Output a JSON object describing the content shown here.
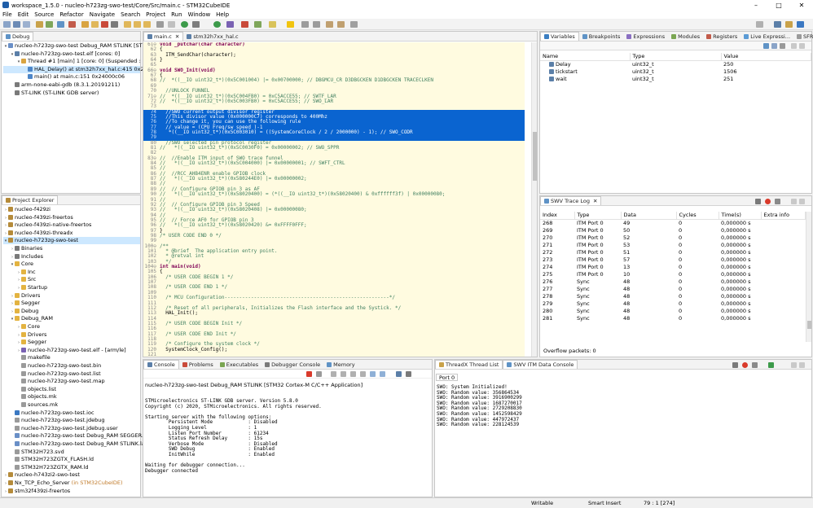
{
  "window": {
    "title": "workspace_1.5.0 - nucleo-h723zg-swo-test/Core/Src/main.c - STM32CubeIDE",
    "minimize": "–",
    "maximize": "□",
    "close": "✕"
  },
  "menu": [
    "File",
    "Edit",
    "Source",
    "Refactor",
    "Navigate",
    "Search",
    "Project",
    "Run",
    "Window",
    "Help"
  ],
  "debug_view": {
    "tab": "Debug",
    "tree": [
      {
        "text": "nucleo-h723zg-swo-test Debug_RAM STLINK [STM32 C",
        "indent": 0,
        "arrow": "▾",
        "icon": "#6a8fc7"
      },
      {
        "text": "nucleo-h723zg-swo-test.elf [cores: 0]",
        "indent": 1,
        "arrow": "▾",
        "icon": "#5b7fa8"
      },
      {
        "text": "Thread #1 [main] 1 [core: 0] (Suspended : Signal :",
        "indent": 2,
        "arrow": "▾",
        "icon": "#d9a441"
      },
      {
        "text": "HAL_Delay() at stm32h7xx_hal.c:415 0x240029",
        "indent": 3,
        "arrow": "",
        "icon": "#4d86c9",
        "selected": true
      },
      {
        "text": "main() at main.c:151 0x24000c06",
        "indent": 3,
        "arrow": "",
        "icon": "#4d86c9"
      },
      {
        "text": "arm-none-eabi-gdb (8.3.1.20191211)",
        "indent": 1,
        "arrow": "",
        "icon": "#7a7a7a"
      },
      {
        "text": "ST-LINK (ST-LINK GDB server)",
        "indent": 1,
        "arrow": "",
        "icon": "#7a7a7a"
      }
    ]
  },
  "project_explorer": {
    "tab": "Project Explorer",
    "tree": [
      {
        "text": "nucleo-f429zi",
        "indent": 0,
        "arrow": "›",
        "icon": "#b58b3a"
      },
      {
        "text": "nucleo-f439zi-freertos",
        "indent": 0,
        "arrow": "›",
        "icon": "#b58b3a"
      },
      {
        "text": "nucleo-f439zi-native-freertos",
        "indent": 0,
        "arrow": "›",
        "icon": "#b58b3a"
      },
      {
        "text": "nucleo-f439zi-threadx",
        "indent": 0,
        "arrow": "›",
        "icon": "#b58b3a"
      },
      {
        "text": "nucleo-h723zg-swo-test",
        "indent": 0,
        "arrow": "▾",
        "icon": "#b58b3a",
        "selected": true
      },
      {
        "text": "Binaries",
        "indent": 1,
        "arrow": "›",
        "icon": "#7a7a7a"
      },
      {
        "text": "Includes",
        "indent": 1,
        "arrow": "›",
        "icon": "#7a7a7a"
      },
      {
        "text": "Core",
        "indent": 1,
        "arrow": "▾",
        "icon": "#e3b341"
      },
      {
        "text": "Inc",
        "indent": 2,
        "arrow": "›",
        "icon": "#e3b341"
      },
      {
        "text": "Src",
        "indent": 2,
        "arrow": "›",
        "icon": "#e3b341"
      },
      {
        "text": "Startup",
        "indent": 2,
        "arrow": "›",
        "icon": "#e3b341"
      },
      {
        "text": "Drivers",
        "indent": 1,
        "arrow": "›",
        "icon": "#e3b341"
      },
      {
        "text": "Segger",
        "indent": 1,
        "arrow": "›",
        "icon": "#e3b341"
      },
      {
        "text": "Debug",
        "indent": 1,
        "arrow": "›",
        "icon": "#e3b341"
      },
      {
        "text": "Debug_RAM",
        "indent": 1,
        "arrow": "▾",
        "icon": "#e3b341"
      },
      {
        "text": "Core",
        "indent": 2,
        "arrow": "›",
        "icon": "#e3b341"
      },
      {
        "text": "Drivers",
        "indent": 2,
        "arrow": "›",
        "icon": "#e3b341"
      },
      {
        "text": "Segger",
        "indent": 2,
        "arrow": "›",
        "icon": "#e3b341"
      },
      {
        "text": "nucleo-h723zg-swo-test.elf - [arm/le]",
        "indent": 2,
        "arrow": "›",
        "icon": "#7a62b3"
      },
      {
        "text": "makefile",
        "indent": 2,
        "arrow": "",
        "icon": "#9a9a9a"
      },
      {
        "text": "nucleo-h723zg-swo-test.bin",
        "indent": 2,
        "arrow": "",
        "icon": "#9a9a9a"
      },
      {
        "text": "nucleo-h723zg-swo-test.list",
        "indent": 2,
        "arrow": "",
        "icon": "#9a9a9a"
      },
      {
        "text": "nucleo-h723zg-swo-test.map",
        "indent": 2,
        "arrow": "",
        "icon": "#9a9a9a"
      },
      {
        "text": "objects.list",
        "indent": 2,
        "arrow": "",
        "icon": "#9a9a9a"
      },
      {
        "text": "objects.mk",
        "indent": 2,
        "arrow": "",
        "icon": "#9a9a9a"
      },
      {
        "text": "sources.mk",
        "indent": 2,
        "arrow": "",
        "icon": "#9a9a9a"
      },
      {
        "text": "nucleo-h723zg-swo-test.ioc",
        "indent": 1,
        "arrow": "",
        "icon": "#3b78c2"
      },
      {
        "text": "nucleo-h723zg-swo-test.jdebug",
        "indent": 1,
        "arrow": "",
        "icon": "#9a9a9a"
      },
      {
        "text": "nucleo-h723zg-swo-test.jdebug.user",
        "indent": 1,
        "arrow": "",
        "icon": "#9a9a9a"
      },
      {
        "text": "nucleo-h723zg-swo-test Debug_RAM SEGGER.launc",
        "indent": 1,
        "arrow": "",
        "icon": "#6a8fc7"
      },
      {
        "text": "nucleo-h723zg-swo-test Debug_RAM STLINK.launch",
        "indent": 1,
        "arrow": "",
        "icon": "#6a8fc7"
      },
      {
        "text": "STM32H723.svd",
        "indent": 1,
        "arrow": "",
        "icon": "#9a9a9a"
      },
      {
        "text": "STM32H723ZGTX_FLASH.ld",
        "indent": 1,
        "arrow": "",
        "icon": "#9a9a9a"
      },
      {
        "text": "STM32H723ZGTX_RAM.ld",
        "indent": 1,
        "arrow": "",
        "icon": "#9a9a9a"
      },
      {
        "text": "nucleo-h743zi2-swo-test",
        "indent": 0,
        "arrow": "›",
        "icon": "#b58b3a"
      },
      {
        "text": "Nx_TCP_Echo_Server",
        "suffix": " (in STM32CubeIDE)",
        "indent": 0,
        "arrow": "›",
        "icon": "#b58b3a"
      },
      {
        "text": "stm32f439zi-freertos",
        "indent": 0,
        "arrow": "›",
        "icon": "#b58b3a"
      }
    ]
  },
  "editor": {
    "tabs": [
      "main.c",
      "stm32h7xx_hal.c"
    ],
    "lines": [
      {
        "n": "61⊖",
        "code": "void _putchar(char character)",
        "kw": true
      },
      {
        "n": "62",
        "code": "{"
      },
      {
        "n": "63",
        "code": "  ITM_SendChar(character);"
      },
      {
        "n": "64",
        "code": "}"
      },
      {
        "n": "65",
        "code": ""
      },
      {
        "n": "66⊖",
        "code": "void SWO_Init(void)",
        "kw": true
      },
      {
        "n": "67",
        "code": "{"
      },
      {
        "n": "68",
        "code": "//  *((__IO uint32_t*)(0x5C001004) |= 0x00700000; // DBGMCU_CR D3DBGCKEN D1DBGCKEN TRACECLKEN",
        "cm": true
      },
      {
        "n": "69",
        "code": ""
      },
      {
        "n": "70",
        "code": "  //UNLOCK FUNNEL",
        "cm": true
      },
      {
        "n": "71⊖",
        "code": "//  *((__IO uint32_t*)(0x5C004FB0) = 0xC5ACCE55; // SWTF_LAR",
        "cm": true
      },
      {
        "n": "72",
        "code": "//  *((__IO uint32_t*)(0x5C003FB0) = 0xC5ACCE55; // SWO_LAR",
        "cm": true
      },
      {
        "n": "73",
        "code": ""
      },
      {
        "n": "74",
        "code": "  //SWO current output divisor register",
        "cm": true,
        "sel": true
      },
      {
        "n": "75",
        "code": "  //This divisor value (0x000000C7) corresponds to 400Mhz",
        "cm": true,
        "sel": true
      },
      {
        "n": "76",
        "code": "  //To change it, you can use the following rule",
        "cm": true,
        "sel": true
      },
      {
        "n": "77",
        "code": "  // value = (CPU Freq/sw speed )-1",
        "cm": true,
        "sel": true
      },
      {
        "n": "78",
        "code": "   *((__IO uint32_t*)(0x5C003010) = ((SystemCoreClock / 2 / 2000000) - 1); // SWO_CODR",
        "cm": true,
        "sel": true
      },
      {
        "n": "79",
        "code": "",
        "sel": true
      },
      {
        "n": "80",
        "code": "  //SWO selected pin protocol register",
        "cm": true
      },
      {
        "n": "81",
        "code": "//   *((__IO uint32_t*)(0x5C0030F0) = 0x00000002; // SWO_SPPR",
        "cm": true
      },
      {
        "n": "82",
        "code": ""
      },
      {
        "n": "83⊖",
        "code": "//  //Enable ITM input of SWO trace funnel",
        "cm": true
      },
      {
        "n": "84",
        "code": "//   *((__IO uint32_t*)(0x5C004000) |= 0x00000001; // SWFT_CTRL",
        "cm": true
      },
      {
        "n": "85",
        "code": "//",
        "cm": true
      },
      {
        "n": "86",
        "code": "//  //RCC_AHB4ENR enable GPIOB clock",
        "cm": true
      },
      {
        "n": "87",
        "code": "//   *((__IO uint32_t*)(0x580244E0) |= 0x00000002;",
        "cm": true
      },
      {
        "n": "88",
        "code": "//",
        "cm": true
      },
      {
        "n": "89",
        "code": "//  // Configure GPIOB pin 3 as AF",
        "cm": true
      },
      {
        "n": "90",
        "code": "//   *((__IO uint32_t*)(0x58020400) = (*((__IO uint32_t*)(0x58020400) & 0xffffff3f) | 0x00000080;",
        "cm": true
      },
      {
        "n": "91",
        "code": "//",
        "cm": true
      },
      {
        "n": "92",
        "code": "//  // Configure GPIOB pin 3 Speed",
        "cm": true
      },
      {
        "n": "93",
        "code": "//   *((__IO uint32_t*)(0x58020408) |= 0x00000080;",
        "cm": true
      },
      {
        "n": "94",
        "code": "//",
        "cm": true
      },
      {
        "n": "95",
        "code": "//  // Force AF0 for GPIOB pin 3",
        "cm": true
      },
      {
        "n": "96",
        "code": "//   *((__IO uint32_t*)(0x58020420) &= 0xFFFF0FFF;",
        "cm": true
      },
      {
        "n": "97",
        "code": "}"
      },
      {
        "n": "98",
        "code": "/* USER CODE END 0 */",
        "cm": true
      },
      {
        "n": "99",
        "code": ""
      },
      {
        "n": "100⊖",
        "code": "/**",
        "cm": true
      },
      {
        "n": "101",
        "code": "  * @brief  The application entry point.",
        "cm": true
      },
      {
        "n": "102",
        "code": "  * @retval int",
        "cm": true
      },
      {
        "n": "103",
        "code": "  */",
        "cm": true
      },
      {
        "n": "104⊖",
        "code": "int main(void)",
        "kw": true
      },
      {
        "n": "105",
        "code": "{"
      },
      {
        "n": "106",
        "code": "  /* USER CODE BEGIN 1 */",
        "cm": true
      },
      {
        "n": "107",
        "code": ""
      },
      {
        "n": "108",
        "code": "  /* USER CODE END 1 */",
        "cm": true
      },
      {
        "n": "109",
        "code": ""
      },
      {
        "n": "110",
        "code": "  /* MCU Configuration--------------------------------------------------------*/",
        "cm": true
      },
      {
        "n": "111",
        "code": ""
      },
      {
        "n": "112",
        "code": "  /* Reset of all peripherals, Initializes the Flash interface and the Systick. */",
        "cm": true
      },
      {
        "n": "113",
        "code": "  HAL_Init();"
      },
      {
        "n": "114",
        "code": ""
      },
      {
        "n": "115",
        "code": "  /* USER CODE BEGIN Init */",
        "cm": true
      },
      {
        "n": "116",
        "code": ""
      },
      {
        "n": "117",
        "code": "  /* USER CODE END Init */",
        "cm": true
      },
      {
        "n": "118",
        "code": ""
      },
      {
        "n": "119",
        "code": "  /* Configure the system clock */",
        "cm": true
      },
      {
        "n": "120",
        "code": "  SystemClock_Config();"
      },
      {
        "n": "121",
        "code": ""
      }
    ]
  },
  "variables_view": {
    "tabs": [
      "Variables",
      "Breakpoints",
      "Expressions",
      "Modules",
      "Registers",
      "Live Expressi...",
      "SFRs"
    ],
    "columns": [
      "Name",
      "Type",
      "Value"
    ],
    "rows": [
      {
        "name": "Delay",
        "type": "uint32_t",
        "value": "250"
      },
      {
        "name": "tickstart",
        "type": "uint32_t",
        "value": "1506"
      },
      {
        "name": "wait",
        "type": "uint32_t",
        "value": "251"
      }
    ]
  },
  "swv_trace": {
    "tab": "SWV Trace Log",
    "columns": [
      "Index",
      "Type",
      "Data",
      "Cycles",
      "Time(s)",
      "Extra info"
    ],
    "rows": [
      [
        "268",
        "ITM Port 0",
        "49",
        "0",
        "0,000000 s",
        ""
      ],
      [
        "269",
        "ITM Port 0",
        "50",
        "0",
        "0,000000 s",
        ""
      ],
      [
        "270",
        "ITM Port 0",
        "52",
        "0",
        "0,000000 s",
        ""
      ],
      [
        "271",
        "ITM Port 0",
        "53",
        "0",
        "0,000000 s",
        ""
      ],
      [
        "272",
        "ITM Port 0",
        "51",
        "0",
        "0,000000 s",
        ""
      ],
      [
        "273",
        "ITM Port 0",
        "57",
        "0",
        "0,000000 s",
        ""
      ],
      [
        "274",
        "ITM Port 0",
        "13",
        "0",
        "0,000000 s",
        ""
      ],
      [
        "275",
        "ITM Port 0",
        "10",
        "0",
        "0,000000 s",
        ""
      ],
      [
        "276",
        "Sync",
        "48",
        "0",
        "0,000000 s",
        ""
      ],
      [
        "277",
        "Sync",
        "48",
        "0",
        "0,000000 s",
        ""
      ],
      [
        "278",
        "Sync",
        "48",
        "0",
        "0,000000 s",
        ""
      ],
      [
        "279",
        "Sync",
        "48",
        "0",
        "0,000000 s",
        ""
      ],
      [
        "280",
        "Sync",
        "48",
        "0",
        "0,000000 s",
        ""
      ],
      [
        "281",
        "Sync",
        "48",
        "0",
        "0,000000 s",
        ""
      ]
    ],
    "overflow": "Overflow packets: 0"
  },
  "console": {
    "tabs": [
      "Console",
      "Problems",
      "Executables",
      "Debugger Console",
      "Memory"
    ],
    "header": "nucleo-h723zg-swo-test Debug_RAM STLINK [STM32 Cortex-M C/C++ Application]",
    "text": "STMicroelectronics ST-LINK GDB server. Version 5.8.0\nCopyright (c) 2020, STMicroelectronics. All rights reserved.\n\nStarting server with the following options:\n        Persistent Mode            : Disabled\n        Logging Level              : 1\n        Listen Port Number         : 61234\n        Status Refresh Delay       : 15s\n        Verbose Mode               : Disabled\n        SWD Debug                  : Enabled\n        InitWhile                  : Enabled\n\nWaiting for debugger connection...\nDebugger connected"
  },
  "swv_itm": {
    "tabs": [
      "ThreadX Thread List",
      "SWV ITM Data Console"
    ],
    "port_tab": "Port 0",
    "text": "SWO: System Initialized!\nSWO: Random value: 356864534\nSWO: Random value: 3916900299\nSWO: Random value: 1687270017\nSWO: Random value: 2729208830\nSWO: Random value: 1452598429\nSWO: Random value: 447972437\nSWO: Random value: 228124539"
  },
  "status": {
    "writable": "Writable",
    "insert": "Smart Insert",
    "position": "79 : 1 [274]"
  }
}
